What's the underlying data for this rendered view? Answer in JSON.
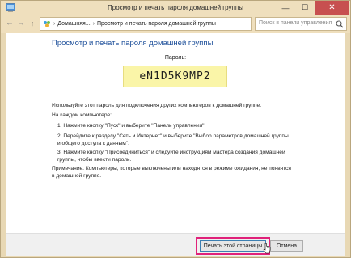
{
  "window": {
    "title": "Просмотр и печать пароля домашней группы",
    "minimize_glyph": "—",
    "maximize_glyph": "☐",
    "close_glyph": "✕"
  },
  "navigation": {
    "back_glyph": "←",
    "forward_glyph": "→",
    "up_glyph": "↑",
    "refresh_glyph": "↻",
    "breadcrumbs": [
      "Домашняя...",
      "Просмотр и печать пароля домашней группы"
    ],
    "breadcrumb_separator": "›",
    "search_placeholder": "Поиск в панели управления"
  },
  "main": {
    "heading": "Просмотр и печать пароля домашней группы",
    "password_label": "Пароль:",
    "password": "eN1D5K9MP2",
    "intro": "Используйте этот пароль для подключения других компьютеров к домашней группе.",
    "on_each_computer": "На каждом компьютере:",
    "steps": [
      "1. Нажмите кнопку \"Пуск\" и выберите \"Панель управления\".",
      "2. Перейдите к разделу \"Сеть и Интернет\" и выберите \"Выбор параметров домашней группы и общего доступа к данным\".",
      "3. Нажмите кнопку \"Присоединиться\" и следуйте инструкциям мастера создания домашней группы, чтобы ввести пароль."
    ],
    "note": "Примечание. Компьютеры, которые выключены или находятся в режиме ожидания, не появятся в домашней группе."
  },
  "footer": {
    "print_button": "Печать этой страницы",
    "cancel_button": "Отмена"
  },
  "colors": {
    "accent": "#1d4f9a",
    "password_bg": "#faf5a8",
    "highlight": "#e0217a",
    "chrome": "#efdfbd"
  }
}
